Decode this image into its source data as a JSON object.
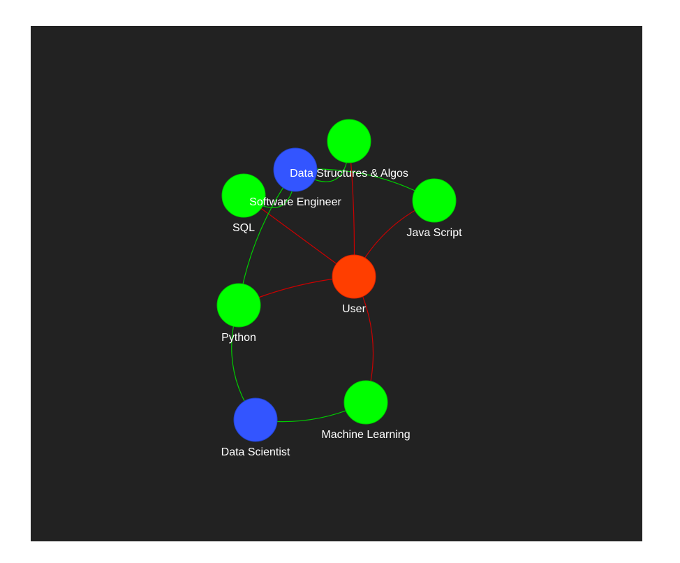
{
  "colors": {
    "background": "#222222",
    "user": "#ff3e00",
    "skill": "#00ff00",
    "role": "#3355ff",
    "user_edge": "#cc0000",
    "role_edge": "#00cc00"
  },
  "nodes": [
    {
      "id": "user",
      "label": "User",
      "kind": "user"
    },
    {
      "id": "dsa",
      "label": "Data Structures & Algos",
      "kind": "skill"
    },
    {
      "id": "swe",
      "label": "Software Engineer",
      "kind": "role"
    },
    {
      "id": "sql",
      "label": "SQL",
      "kind": "skill"
    },
    {
      "id": "js",
      "label": "Java Script",
      "kind": "skill"
    },
    {
      "id": "python",
      "label": "Python",
      "kind": "skill"
    },
    {
      "id": "ds",
      "label": "Data Scientist",
      "kind": "role"
    },
    {
      "id": "ml",
      "label": "Machine Learning",
      "kind": "skill"
    }
  ],
  "edges": [
    {
      "from": "user",
      "to": "dsa",
      "kind": "user"
    },
    {
      "from": "user",
      "to": "sql",
      "kind": "user"
    },
    {
      "from": "user",
      "to": "js",
      "kind": "user"
    },
    {
      "from": "user",
      "to": "python",
      "kind": "user"
    },
    {
      "from": "user",
      "to": "ml",
      "kind": "user"
    },
    {
      "from": "swe",
      "to": "dsa",
      "kind": "role"
    },
    {
      "from": "swe",
      "to": "sql",
      "kind": "role"
    },
    {
      "from": "swe",
      "to": "js",
      "kind": "role"
    },
    {
      "from": "swe",
      "to": "python",
      "kind": "role"
    },
    {
      "from": "ds",
      "to": "python",
      "kind": "role"
    },
    {
      "from": "ds",
      "to": "ml",
      "kind": "role"
    }
  ]
}
